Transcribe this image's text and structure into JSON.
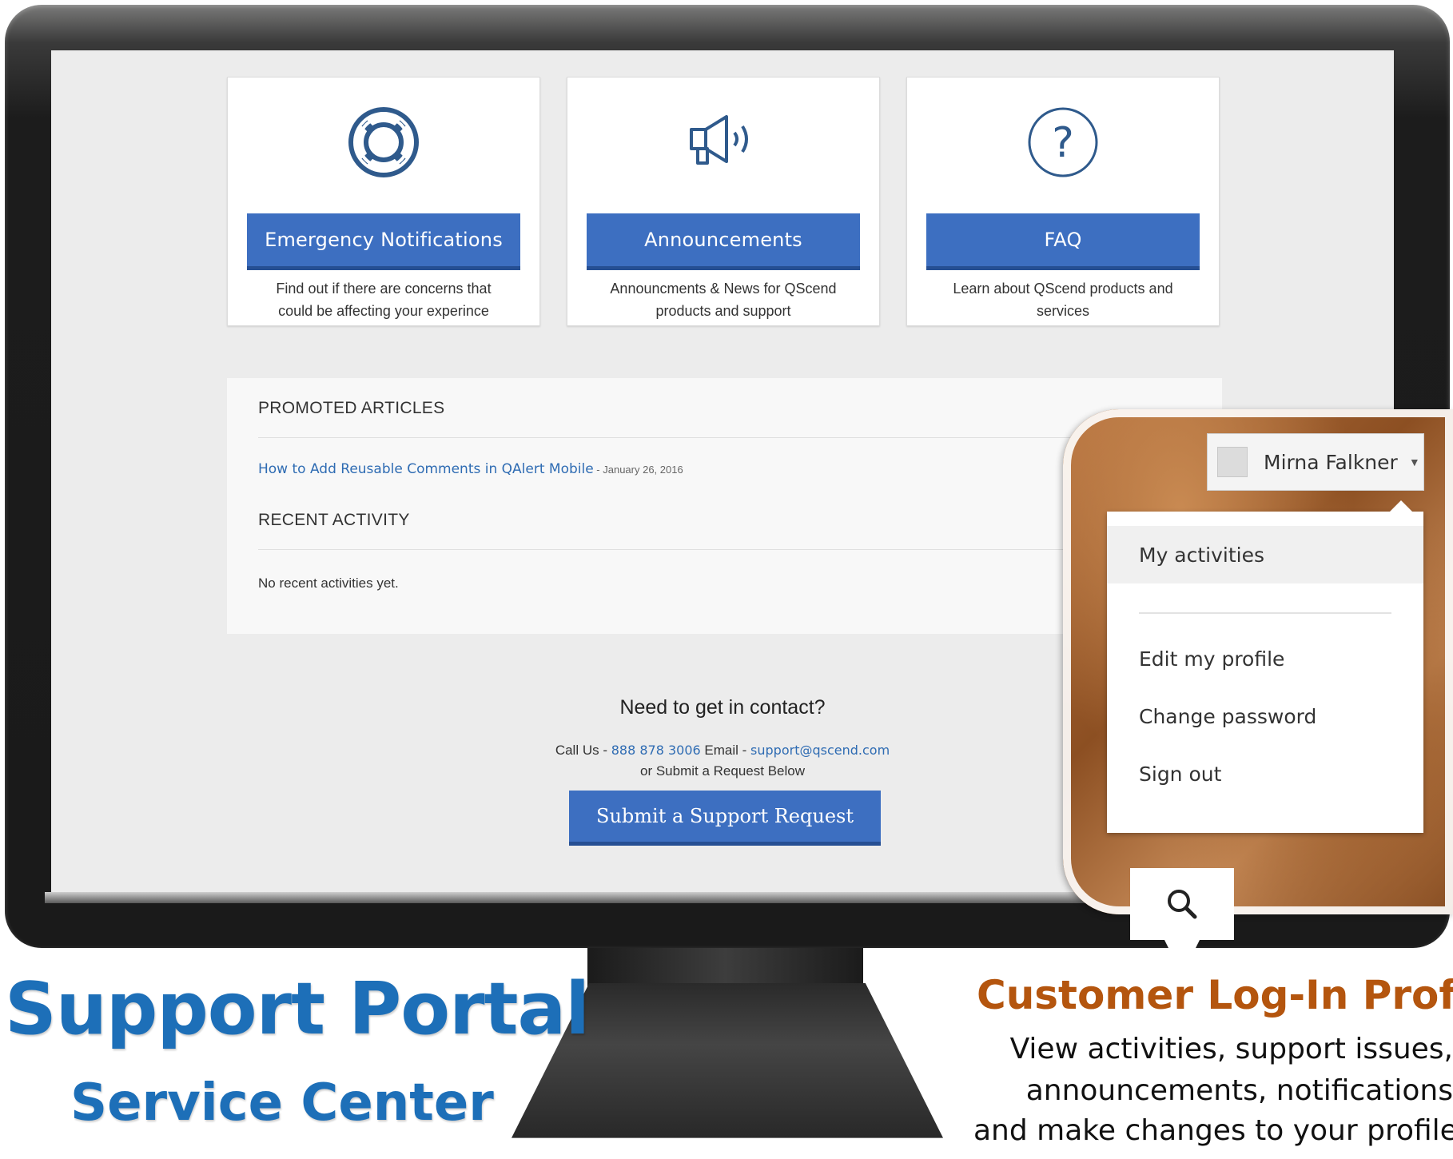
{
  "cards": [
    {
      "icon": "lifebuoy-icon",
      "button": "Emergency Notifications",
      "desc1": "Find out if there are concerns that",
      "desc2": "could be affecting your experince"
    },
    {
      "icon": "megaphone-icon",
      "button": "Announcements",
      "desc1": "Announcments & News for QScend",
      "desc2": "products and support"
    },
    {
      "icon": "question-icon",
      "button": "FAQ",
      "desc1": "Learn about QScend products and",
      "desc2": "services"
    }
  ],
  "promoted": {
    "heading": "PROMOTED ARTICLES",
    "article_title": "How to Add Reusable Comments in QAlert Mobile",
    "article_date": " - January 26, 2016"
  },
  "recent": {
    "heading": "RECENT ACTIVITY",
    "empty": "No recent activities yet."
  },
  "contact": {
    "title": "Need to get in contact?",
    "call_label": "Call Us - ",
    "phone": "888 878 3006",
    "email_label": " Email - ",
    "email": "support@qscend.com",
    "or_line": "or Submit a Request Below",
    "submit": "Submit a Support Request"
  },
  "profile": {
    "user_name": "Mirna Falkner",
    "caret": "▼",
    "menu": [
      "My activities",
      "Edit my profile",
      "Change password",
      "Sign out"
    ]
  },
  "captions": {
    "title": "Support Portal",
    "subtitle": "Service Center",
    "profile_title": "Customer Log-In Profile",
    "profile_line1": "View activities, support issues,",
    "profile_line2": "announcements, notifications",
    "profile_line3": "and make changes to your profile"
  },
  "colors": {
    "accent_blue": "#3d6fc1",
    "link_blue": "#2f6cb3",
    "brand_blue": "#1d6fb8",
    "profile_orange": "#b4550e"
  }
}
